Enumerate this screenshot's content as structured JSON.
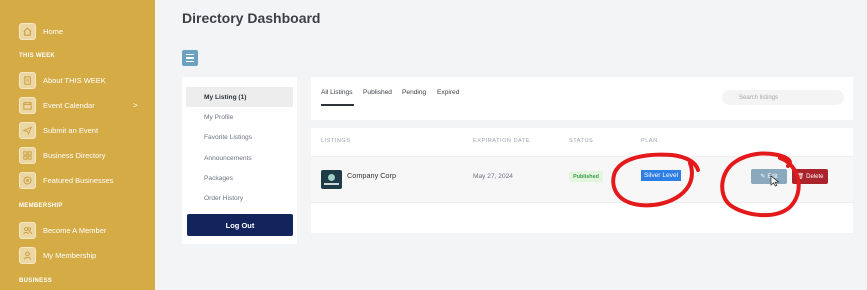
{
  "sidebar": {
    "home": {
      "label": "Home",
      "icon": "home-icon"
    },
    "sections": [
      {
        "title": "THIS WEEK"
      },
      {
        "title": "MEMBERSHIP"
      },
      {
        "title": "BUSINESS"
      }
    ],
    "this_week_items": [
      {
        "label": "About THIS WEEK",
        "icon": "document-icon"
      },
      {
        "label": "Event Calendar",
        "icon": "calendar-icon",
        "chevron": ">"
      },
      {
        "label": "Submit an Event",
        "icon": "send-icon"
      },
      {
        "label": "Business Directory",
        "icon": "grid-icon"
      },
      {
        "label": "Featured Businesses",
        "icon": "badge-icon"
      }
    ],
    "membership_items": [
      {
        "label": "Become A Member",
        "icon": "users-icon"
      },
      {
        "label": "My Membership",
        "icon": "user-icon"
      }
    ]
  },
  "page": {
    "title": "Directory Dashboard"
  },
  "account_menu": {
    "items": [
      "My Listing (1)",
      "My Profile",
      "Favorite Listings",
      "Announcements",
      "Packages",
      "Order History"
    ],
    "active_index": 0,
    "logout_label": "Log Out"
  },
  "listing_tabs": {
    "tabs": [
      "All Listings",
      "Published",
      "Pending",
      "Expired"
    ],
    "active_index": 0,
    "search_placeholder": "Search listings"
  },
  "table": {
    "columns": [
      "LISTINGS",
      "EXPIRATION DATE",
      "STATUS",
      "PLAN"
    ],
    "rows": [
      {
        "listing": "Company Corp",
        "expiration_date": "May 27, 2024",
        "status": "Published",
        "plan": "Silver Level",
        "edit_label": "Edit",
        "delete_label": "Delete"
      }
    ]
  },
  "colors": {
    "sidebar_bg": "#d4ab45",
    "logout_bg": "#13245c",
    "status_published": "#3a9a46",
    "plan_highlight": "#2f7ee6",
    "edit_bg": "#8aa9bd",
    "delete_bg": "#a9242c",
    "annotation_red": "#e3191b"
  }
}
